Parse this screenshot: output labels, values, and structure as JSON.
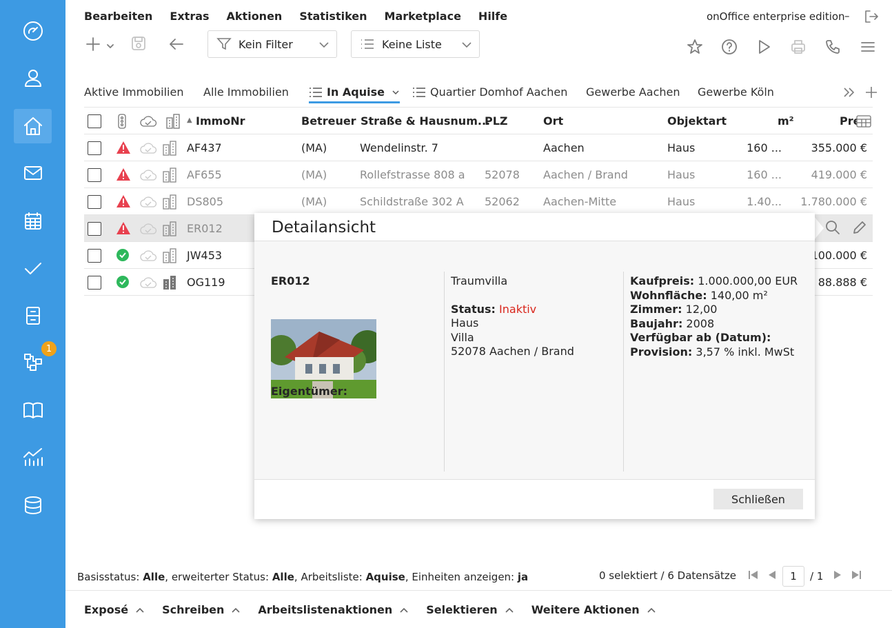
{
  "menu": [
    "Bearbeiten",
    "Extras",
    "Aktionen",
    "Statistiken",
    "Marketplace",
    "Hilfe"
  ],
  "edition": "onOffice enterprise edition",
  "edition_sep": "–",
  "filter": {
    "label": "Kein Filter"
  },
  "list": {
    "label": "Keine Liste"
  },
  "tabs": [
    "Aktive Immobilien",
    "Alle Immobilien",
    "In Aquise",
    "Quartier Domhof Aachen",
    "Gewerbe Aachen",
    "Gewerbe Köln"
  ],
  "columns": {
    "immonr": "ImmoNr",
    "betreuer": "Betreuer",
    "strasse": "Straße & Hausnum...",
    "plz": "PLZ",
    "ort": "Ort",
    "objektart": "Objektart",
    "m2": "m²",
    "preis": "Preis"
  },
  "rows": [
    {
      "immonr": "AF437",
      "betreuer": "(MA)",
      "strasse": "Wendelinstr. 7",
      "plz": "",
      "ort": "Aachen",
      "objektart": "Haus",
      "m2": "160 ...",
      "preis": "355.000 €",
      "status": "warning"
    },
    {
      "immonr": "AF655",
      "betreuer": "(MA)",
      "strasse": "Rollefstrasse 808 a",
      "plz": "52078",
      "ort": "Aachen / Brand",
      "objektart": "Haus",
      "m2": "160 ...",
      "preis": "419.000 €",
      "status": "warning"
    },
    {
      "immonr": "DS805",
      "betreuer": "(MA)",
      "strasse": "Schildstraße 302 A",
      "plz": "52062",
      "ort": "Aachen-Mitte",
      "objektart": "Haus",
      "m2": "1.40...",
      "preis": "1.780.000 €",
      "status": "warning"
    },
    {
      "immonr": "ER012",
      "betreuer": "",
      "strasse": "",
      "plz": "",
      "ort": "",
      "objektart": "",
      "m2": "",
      "preis": "",
      "status": "warning"
    },
    {
      "immonr": "JW453",
      "betreuer": "",
      "strasse": "",
      "plz": "",
      "ort": "",
      "objektart": "",
      "m2": "",
      "preis": "100.000 €",
      "status": "ok"
    },
    {
      "immonr": "OG119",
      "betreuer": "",
      "strasse": "",
      "plz": "",
      "ort": "",
      "objektart": "",
      "m2": "",
      "preis": "88.888 €",
      "status": "ok"
    }
  ],
  "detail": {
    "title": "Detailansicht",
    "immonr": "ER012",
    "eigentuemer_label": "Eigentümer:",
    "name": "Traumvilla",
    "status_label": "Status:",
    "status_value": "Inaktiv",
    "type1": "Haus",
    "type2": "Villa",
    "address": "52078 Aachen / Brand",
    "facts": [
      {
        "label": "Kaufpreis:",
        "value": " 1.000.000,00 EUR"
      },
      {
        "label": "Wohnfläche:",
        "value": " 140,00 m²"
      },
      {
        "label": "Zimmer:",
        "value": " 12,00"
      },
      {
        "label": "Baujahr:",
        "value": " 2008"
      },
      {
        "label": "Verfügbar ab (Datum):",
        "value": ""
      },
      {
        "label": "Provision:",
        "value": " 3,57 % inkl. MwSt"
      }
    ],
    "close": "Schließen"
  },
  "status": {
    "p1": "Basisstatus: ",
    "v1": "Alle",
    "p2": ", erweiterter Status: ",
    "v2": "Alle",
    "p3": ", Arbeitsliste: ",
    "v3": "Aquise",
    "p4": ", Einheiten anzeigen: ",
    "v4": "ja"
  },
  "counter": "0 selektiert / 6 Datensätze",
  "pager": {
    "page": "1",
    "total": "/ 1"
  },
  "actions": [
    "Exposé",
    "Schreiben",
    "Arbeitslistenaktionen",
    "Selektieren",
    "Weitere Aktionen"
  ],
  "notification_count": "1"
}
